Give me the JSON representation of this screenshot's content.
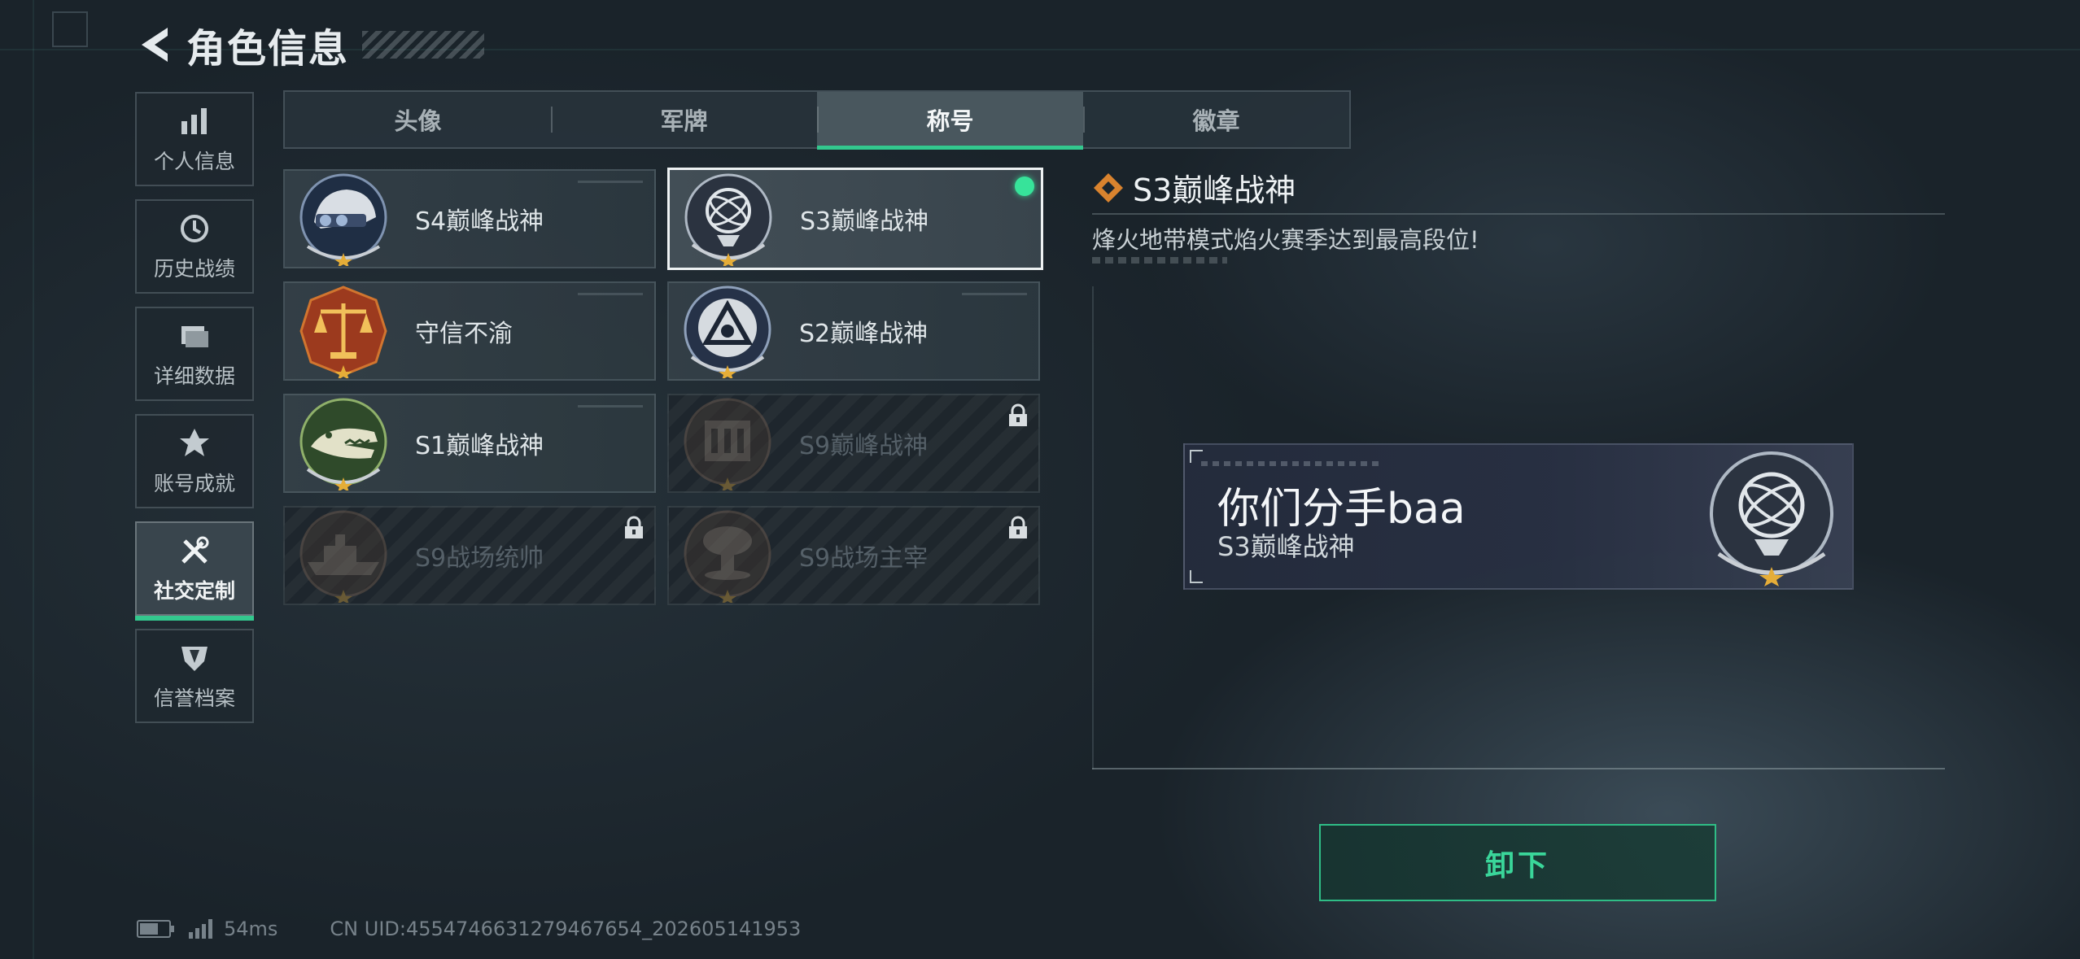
{
  "header": {
    "title": "角色信息"
  },
  "sidebar": {
    "items": [
      {
        "label": "个人信息",
        "icon": "bar-chart-icon"
      },
      {
        "label": "历史战绩",
        "icon": "history-clock-icon"
      },
      {
        "label": "详细数据",
        "icon": "folder-icon"
      },
      {
        "label": "账号成就",
        "icon": "achievement-icon"
      },
      {
        "label": "社交定制",
        "icon": "tools-icon",
        "active": true
      },
      {
        "label": "信誉档案",
        "icon": "credit-shield-icon"
      }
    ]
  },
  "tabs": [
    {
      "label": "头像"
    },
    {
      "label": "军牌"
    },
    {
      "label": "称号",
      "active": true
    },
    {
      "label": "徽章"
    }
  ],
  "titles": [
    {
      "name": "S4巅峰战神",
      "emblem": "helmet-emblem-icon",
      "locked": false
    },
    {
      "name": "S3巅峰战神",
      "emblem": "globe-emblem-icon",
      "locked": false,
      "selected": true,
      "equipped": true
    },
    {
      "name": "守信不渝",
      "emblem": "scales-emblem-icon",
      "locked": false
    },
    {
      "name": "S2巅峰战神",
      "emblem": "triangle-emblem-icon",
      "locked": false
    },
    {
      "name": "S1巅峰战神",
      "emblem": "crocodile-emblem-icon",
      "locked": false
    },
    {
      "name": "S9巅峰战神",
      "emblem": "building-emblem-icon",
      "locked": true
    },
    {
      "name": "S9战场统帅",
      "emblem": "ship-emblem-icon",
      "locked": true
    },
    {
      "name": "S9战场主宰",
      "emblem": "mushroom-cloud-emblem-icon",
      "locked": true
    }
  ],
  "detail": {
    "title": "S3巅峰战神",
    "description": "烽火地带模式焰火赛季达到最高段位!"
  },
  "nameplate": {
    "player_name": "你们分手baa",
    "title": "S3巅峰战神"
  },
  "actions": {
    "unequip_label": "卸下"
  },
  "status": {
    "ping": "54ms",
    "uid": "CN UID:4554746631279467654_202605141953"
  },
  "colors": {
    "accent": "#33c88e",
    "accent_text": "#3ad69a",
    "equipped_dot": "#37e39a",
    "diamond": "#d9832e"
  }
}
